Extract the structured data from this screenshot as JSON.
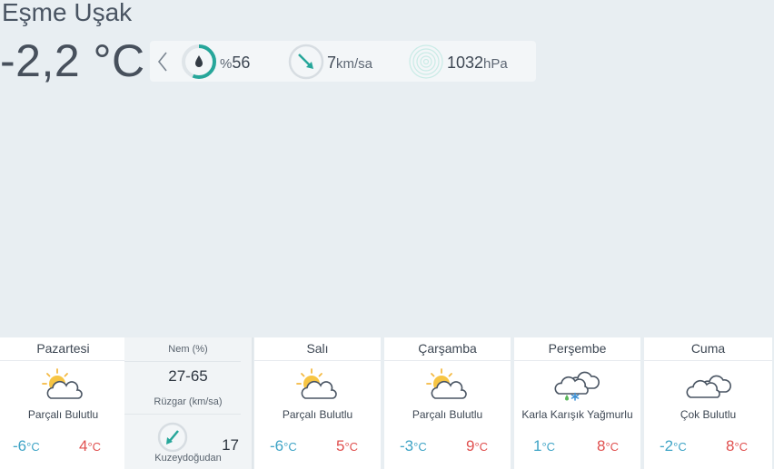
{
  "location": "Eşme Uşak",
  "current": {
    "temp": "-2,2 °C",
    "humidity_prefix": "%",
    "humidity": "56",
    "wind": "7",
    "wind_unit": "km/sa",
    "pressure": "1032",
    "pressure_unit": "hPa"
  },
  "colors": {
    "accent": "#26a69a",
    "cold": "#3fa4c6",
    "warm": "#e0504f"
  },
  "days": [
    {
      "name": "Pazartesi",
      "icon": "partly-cloudy-icon",
      "desc": "Parçalı Bulutlu",
      "lo": "-6",
      "hi": "4"
    },
    {
      "name": "Salı",
      "icon": "partly-cloudy-icon",
      "desc": "Parçalı Bulutlu",
      "lo": "-6",
      "hi": "5"
    },
    {
      "name": "Çarşamba",
      "icon": "partly-cloudy-icon",
      "desc": "Parçalı Bulutlu",
      "lo": "-3",
      "hi": "9"
    },
    {
      "name": "Perşembe",
      "icon": "sleet-icon",
      "desc": "Karla Karışık Yağmurlu",
      "lo": "1",
      "hi": "8"
    },
    {
      "name": "Cuma",
      "icon": "cloudy-icon",
      "desc": "Çok Bulutlu",
      "lo": "-2",
      "hi": "8"
    }
  ],
  "detail": {
    "humidity_label": "Nem (%)",
    "humidity_range": "27-65",
    "wind_label": "Rüzgar (km/sa)",
    "wind_dir": "Kuzeydoğudan",
    "wind_speed": "17"
  },
  "units": {
    "deg": "°C"
  }
}
